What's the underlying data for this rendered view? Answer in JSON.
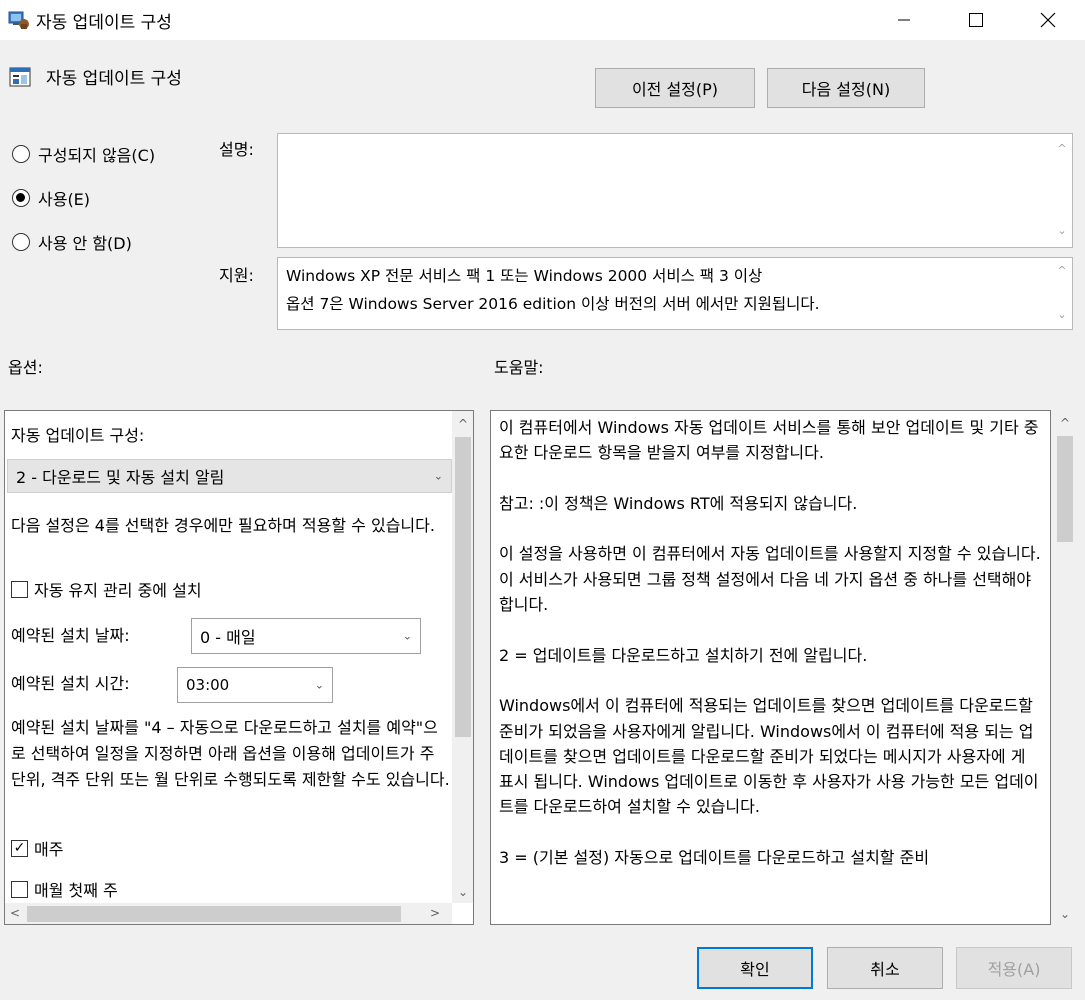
{
  "window": {
    "title": "자동 업데이트 구성",
    "minimize_glyph": "—",
    "maximize_glyph": "☐",
    "close_glyph": "✕"
  },
  "header": {
    "title": "자동 업데이트 구성",
    "prev_button": "이전 설정(P)",
    "next_button": "다음 설정(N)"
  },
  "state": {
    "options": [
      {
        "label": "구성되지 않음(C)",
        "checked": false
      },
      {
        "label": "사용(E)",
        "checked": true
      },
      {
        "label": "사용 안 함(D)",
        "checked": false
      }
    ]
  },
  "description": {
    "label": "설명:",
    "text": ""
  },
  "support": {
    "label": "지원:",
    "text": "Windows XP 전문 서비스 팩 1 또는 Windows 2000 서비스 팩 3 이상\n옵션 7은 Windows Server 2016 edition 이상 버전의 서버 에서만 지원됩니다."
  },
  "options_label": "옵션:",
  "help_label": "도움말:",
  "options_pane": {
    "heading": "자동 업데이트 구성:",
    "main_select": "2 - 다운로드 및 자동 설치 알림",
    "note": "다음 설정은 4를 선택한 경우에만 필요하며 적용할 수 있습니다.",
    "maintenance_checkbox": {
      "label": "자동 유지 관리 중에 설치",
      "checked": false
    },
    "install_day_label": "예약된 설치 날짜:",
    "install_day_value": "0 - 매일",
    "install_time_label": "예약된 설치 시간:",
    "install_time_value": "03:00",
    "weekly_note": "예약된 설치 날짜를 \"4 – 자동으로 다운로드하고 설치를 예약\"으로 선택하여 일정을 지정하면 아래 옵션을 이용해 업데이트가 주 단위, 격주 단위 또는 월 단위로 수행되도록 제한할 수도 있습니다.",
    "weekly_checkbox": {
      "label": "매주",
      "checked": true
    },
    "first_week_checkbox": {
      "label": "매월 첫째 주",
      "checked": false
    }
  },
  "help_pane": {
    "paragraphs": [
      "이 컴퓨터에서 Windows 자동 업데이트 서비스를 통해 보안 업데이트 및 기타 중요한 다운로드 항목을 받을지 여부를 지정합니다.",
      "참고: :이 정책은 Windows RT에 적용되지 않습니다.",
      "이 설정을 사용하면 이 컴퓨터에서 자동 업데이트를 사용할지 지정할 수 있습니다. 이 서비스가 사용되면 그룹 정책 설정에서 다음 네 가지 옵션 중 하나를 선택해야 합니다.",
      " 2 = 업데이트를 다운로드하고 설치하기 전에 알립니다.",
      " Windows에서 이 컴퓨터에 적용되는 업데이트를 찾으면 업데이트를 다운로드할 준비가 되었음을 사용자에게 알립니다. Windows에서 이 컴퓨터에 적용 되는 업데이트를 찾으면 업데이트를 다운로드할 준비가 되었다는 메시지가 사용자에 게 표시 됩니다. Windows 업데이트로 이동한 후 사용자가 사용 가능한 모든 업데이트를 다운로드하여 설치할 수 있습니다.",
      " 3 = (기본 설정) 자동으로 업데이트를 다운로드하고 설치할 준비"
    ]
  },
  "footer": {
    "ok": "확인",
    "cancel": "취소",
    "apply": "적용(A)"
  },
  "icons": {
    "up_arrow": "^",
    "down_arrow": "⌄",
    "left_arrow": "<",
    "right_arrow": ">",
    "chevron": "⌄",
    "check": "✓"
  }
}
